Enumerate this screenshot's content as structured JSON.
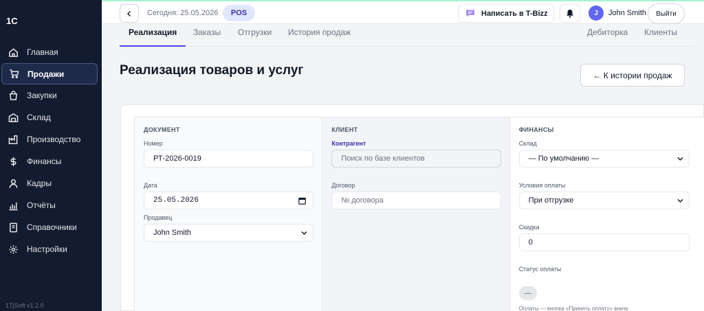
{
  "app": {
    "logo": "1С",
    "version": "1TjSoft v1.2.0"
  },
  "sidebar": {
    "items": [
      {
        "label": "Главная",
        "icon": "home-icon"
      },
      {
        "label": "Продажи",
        "icon": "cart-icon",
        "active": true
      },
      {
        "label": "Закупки",
        "icon": "bag-icon"
      },
      {
        "label": "Склад",
        "icon": "warehouse-icon"
      },
      {
        "label": "Производство",
        "icon": "factory-icon"
      },
      {
        "label": "Финансы",
        "icon": "dollar-icon"
      },
      {
        "label": "Кадры",
        "icon": "user-icon"
      },
      {
        "label": "Отчёты",
        "icon": "bar-chart-icon"
      },
      {
        "label": "Справочники",
        "icon": "book-icon"
      },
      {
        "label": "Настройки",
        "icon": "gear-icon"
      }
    ]
  },
  "topbar": {
    "today": "Сегодня: 25.05.2026",
    "pos": "POS",
    "tbizz": "Написать в T-Bizz",
    "user_initial": "J",
    "user_name": "John Smith",
    "logout": "Выйти"
  },
  "tabs": {
    "left": [
      "Реализация",
      "Заказы",
      "Отгрузки",
      "История продаж"
    ],
    "right": [
      "Дебиторка",
      "Клиенты"
    ]
  },
  "page": {
    "title": "Реализация товаров и услуг",
    "history_button": "← К истории продаж"
  },
  "form": {
    "document": {
      "header": "ДОКУМЕНТ",
      "number_label": "Номер",
      "number_value": "РТ-2026-0019",
      "date_label": "Дата",
      "date_value": "25.05.2026",
      "seller_label": "Продавец",
      "seller_value": "John Smith"
    },
    "client": {
      "header": "КЛИЕНТ",
      "counterparty_label": "Контрагент",
      "counterparty_placeholder": "Поиск по базе клиентов",
      "contract_label": "Договор",
      "contract_placeholder": "№ договора"
    },
    "finance": {
      "header": "ФИНАНСЫ",
      "warehouse_label": "Склад",
      "warehouse_value": "— По умолчанию —",
      "terms_label": "Условия оплаты",
      "terms_value": "При отгрузке",
      "discount_label": "Скидка",
      "discount_value": "0",
      "status_label": "Статус оплаты",
      "status_value": "—",
      "note": "Оплаты — кнопка «Принять оплату» внизу"
    }
  },
  "colors": {
    "accent": "#4f46e5",
    "sidebar_bg": "#131b2e",
    "pos_bg": "#e0e7ff"
  }
}
